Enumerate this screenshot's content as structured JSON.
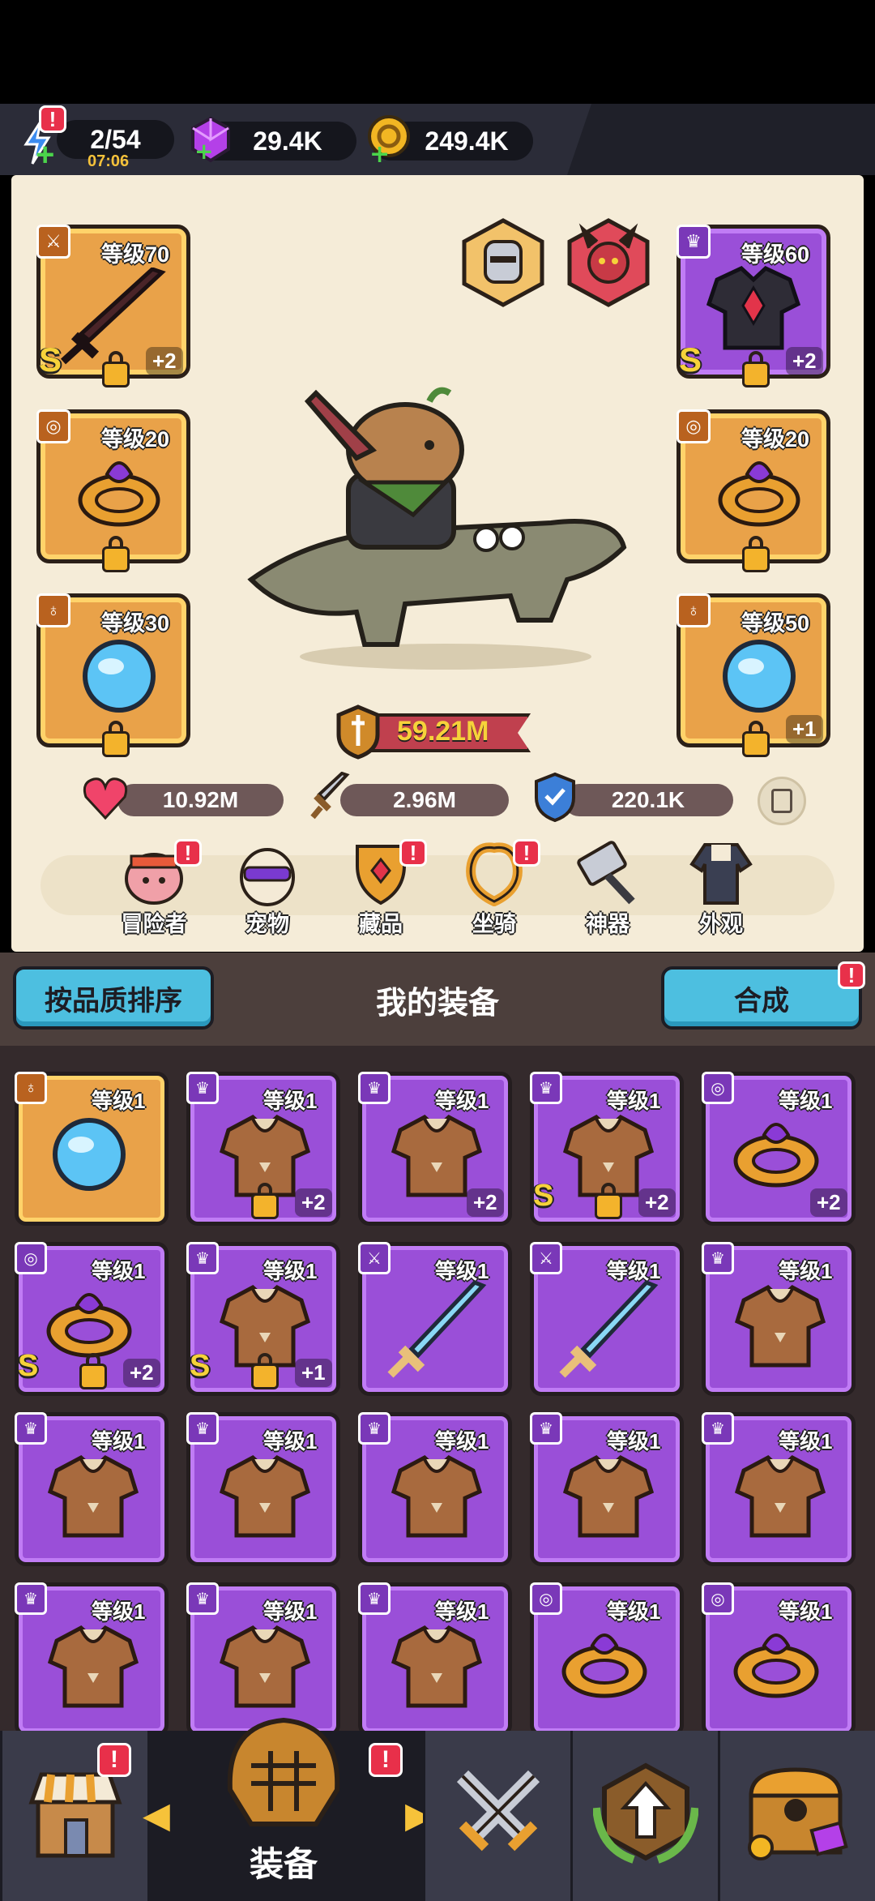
{
  "resources": {
    "energy": "2/54",
    "energy_timer": "07:06",
    "gems": "29.4K",
    "gold": "249.4K"
  },
  "hero_slots": {
    "weapon": {
      "level": "等级70",
      "plus": "+2",
      "grade": "S"
    },
    "armor": {
      "level": "等级60",
      "plus": "+2",
      "grade": "S"
    },
    "ring_left": {
      "level": "等级20"
    },
    "ring_right": {
      "level": "等级20"
    },
    "necklace_left": {
      "level": "等级30"
    },
    "necklace_right": {
      "level": "等级50",
      "plus": "+1"
    }
  },
  "power": "59.21M",
  "stats": {
    "hp": "10.92M",
    "attack": "2.96M",
    "defense": "220.1K"
  },
  "nav": [
    {
      "label": "冒险者",
      "badge": "!"
    },
    {
      "label": "宠物"
    },
    {
      "label": "藏品",
      "badge": "!"
    },
    {
      "label": "坐骑",
      "badge": "!"
    },
    {
      "label": "神器"
    },
    {
      "label": "外观"
    }
  ],
  "equipment_bar": {
    "sort_button": "按品质排序",
    "title": "我的装备",
    "merge_button": "合成",
    "merge_badge": "!"
  },
  "items": [
    {
      "level": "等级1",
      "type": "necklace",
      "rarity": "orange"
    },
    {
      "level": "等级1",
      "type": "armor",
      "plus": "+2",
      "lock": true
    },
    {
      "level": "等级1",
      "type": "armor",
      "plus": "+2"
    },
    {
      "level": "等级1",
      "type": "armor",
      "plus": "+2",
      "grade": "S",
      "lock": true
    },
    {
      "level": "等级1",
      "type": "ring",
      "plus": "+2"
    },
    {
      "level": "等级1",
      "type": "ring",
      "plus": "+2",
      "grade": "S",
      "lock": true
    },
    {
      "level": "等级1",
      "type": "armor",
      "plus": "+1",
      "grade": "S",
      "lock": true
    },
    {
      "level": "等级1",
      "type": "weapon"
    },
    {
      "level": "等级1",
      "type": "weapon"
    },
    {
      "level": "等级1",
      "type": "armor"
    },
    {
      "level": "等级1",
      "type": "armor"
    },
    {
      "level": "等级1",
      "type": "armor"
    },
    {
      "level": "等级1",
      "type": "armor"
    },
    {
      "level": "等级1",
      "type": "armor"
    },
    {
      "level": "等级1",
      "type": "armor"
    },
    {
      "level": "等级1",
      "type": "armor"
    },
    {
      "level": "等级1",
      "type": "armor"
    },
    {
      "level": "等级1",
      "type": "armor"
    },
    {
      "level": "等级1",
      "type": "ring"
    },
    {
      "level": "等级1",
      "type": "ring"
    }
  ],
  "bottom_nav": {
    "active_label": "装备",
    "badge_shop": "!",
    "badge_equip": "!"
  },
  "colors": {
    "purple": "#9a4fd8",
    "orange": "#e9a249",
    "badge": "#e8304a",
    "button_blue": "#4dbfe0"
  }
}
